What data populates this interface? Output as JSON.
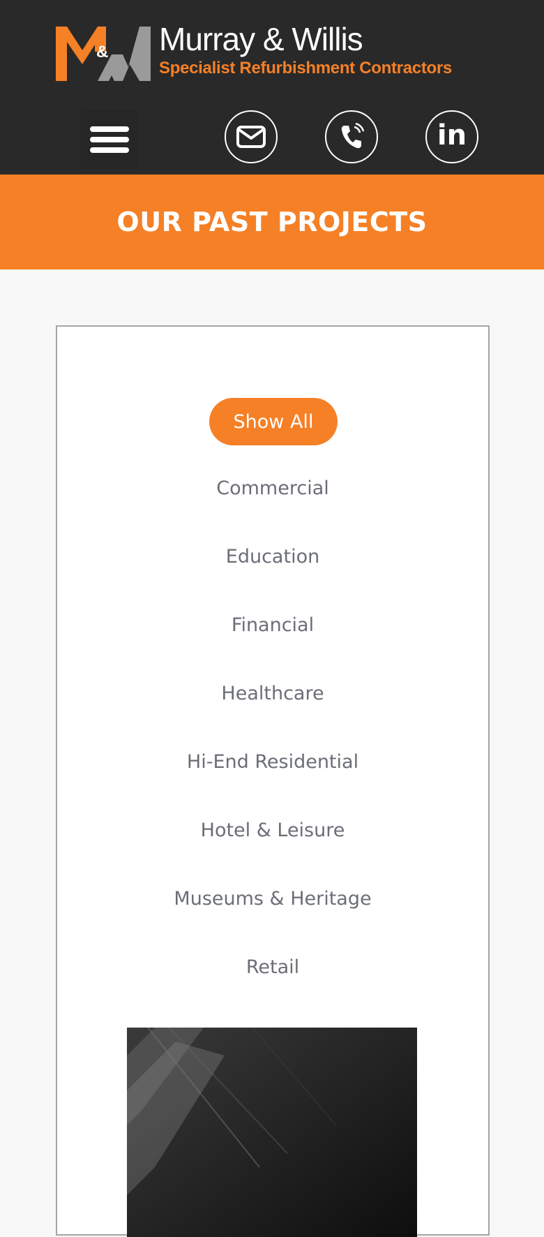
{
  "header": {
    "brand_name": "Murray & Willis",
    "tagline": "Specialist Refurbishment Contractors",
    "logo_ampersand": "&",
    "brand_colors": {
      "orange": "#f58026",
      "grey": "#999999",
      "dark": "#292929"
    },
    "icons": [
      "menu-icon",
      "email-icon",
      "phone-icon",
      "linkedin-icon"
    ],
    "linkedin_label": "in"
  },
  "banner": {
    "title": "OUR PAST PROJECTS"
  },
  "filters": {
    "active": "Show All",
    "items": [
      "Commercial",
      "Education",
      "Financial",
      "Healthcare",
      "Hi-End Residential",
      "Hotel & Leisure",
      "Museums & Heritage",
      "Retail"
    ]
  }
}
